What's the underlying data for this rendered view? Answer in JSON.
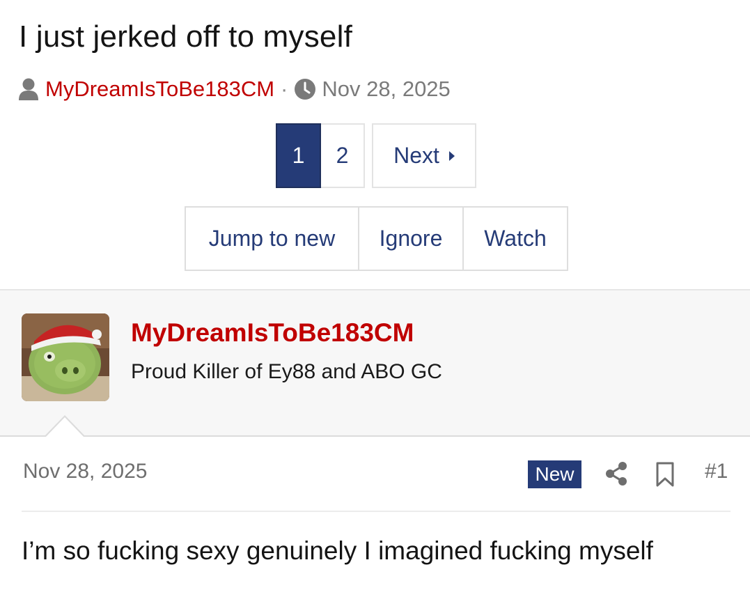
{
  "thread": {
    "title": "I just jerked off to myself",
    "author": "MyDreamIsToBe183CM",
    "separator": "·",
    "date": "Nov 28, 2025"
  },
  "pagination": {
    "pages": [
      "1",
      "2"
    ],
    "current": "1",
    "next_label": "Next"
  },
  "actions": {
    "jump_label": "Jump to new",
    "ignore_label": "Ignore",
    "watch_label": "Watch"
  },
  "post": {
    "username": "MyDreamIsToBe183CM",
    "user_title": "Proud Killer of Ey88 and ABO GC",
    "date": "Nov 28, 2025",
    "badge": "New",
    "number": "#1",
    "body": "I’m so fucking sexy genuinely I imagined fucking myself"
  },
  "colors": {
    "accent": "#253b77",
    "username": "#c00000",
    "muted": "#6e6e6e"
  },
  "icons": {
    "user": "user-icon",
    "clock": "clock-icon",
    "next": "caret-right-icon",
    "share": "share-icon",
    "bookmark": "bookmark-icon"
  }
}
